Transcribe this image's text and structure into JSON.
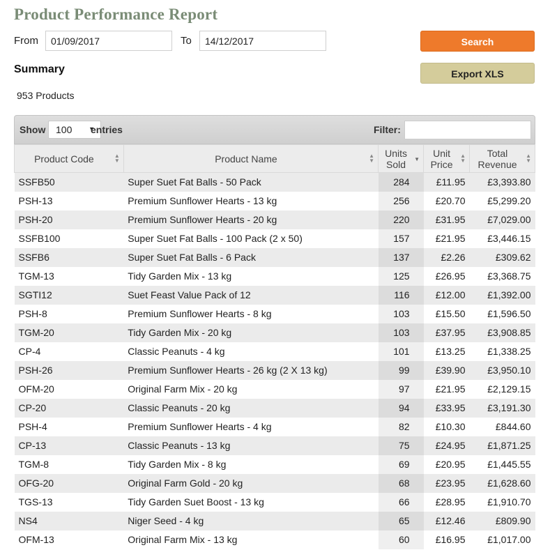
{
  "page": {
    "title": "Product Performance Report"
  },
  "date_range": {
    "from_label": "From",
    "from_value": "01/09/2017",
    "to_label": "To",
    "to_value": "14/12/2017"
  },
  "buttons": {
    "search": "Search",
    "export": "Export XLS"
  },
  "summary": {
    "heading": "Summary",
    "count": "953 Products"
  },
  "table_controls": {
    "show_label": "Show",
    "show_value": "100",
    "entries_label": "entries",
    "filter_label": "Filter:",
    "filter_value": ""
  },
  "columns": [
    {
      "label": "Product Code"
    },
    {
      "label": "Product Name"
    },
    {
      "label": "Units Sold",
      "sorted": "descending"
    },
    {
      "label": "Unit Price"
    },
    {
      "label": "Total Revenue"
    }
  ],
  "rows": [
    {
      "code": "SSFB50",
      "name": "Super Suet Fat Balls - 50 Pack",
      "units": "284",
      "price": "£11.95",
      "revenue": "£3,393.80"
    },
    {
      "code": "PSH-13",
      "name": "Premium Sunflower Hearts - 13 kg",
      "units": "256",
      "price": "£20.70",
      "revenue": "£5,299.20"
    },
    {
      "code": "PSH-20",
      "name": "Premium Sunflower Hearts - 20 kg",
      "units": "220",
      "price": "£31.95",
      "revenue": "£7,029.00"
    },
    {
      "code": "SSFB100",
      "name": "Super Suet Fat Balls - 100 Pack (2 x 50)",
      "units": "157",
      "price": "£21.95",
      "revenue": "£3,446.15"
    },
    {
      "code": "SSFB6",
      "name": "Super Suet Fat Balls - 6 Pack",
      "units": "137",
      "price": "£2.26",
      "revenue": "£309.62"
    },
    {
      "code": "TGM-13",
      "name": "Tidy Garden Mix - 13 kg",
      "units": "125",
      "price": "£26.95",
      "revenue": "£3,368.75"
    },
    {
      "code": "SGTI12",
      "name": "Suet Feast Value Pack of 12",
      "units": "116",
      "price": "£12.00",
      "revenue": "£1,392.00"
    },
    {
      "code": "PSH-8",
      "name": "Premium Sunflower Hearts - 8 kg",
      "units": "103",
      "price": "£15.50",
      "revenue": "£1,596.50"
    },
    {
      "code": "TGM-20",
      "name": "Tidy Garden Mix - 20 kg",
      "units": "103",
      "price": "£37.95",
      "revenue": "£3,908.85"
    },
    {
      "code": "CP-4",
      "name": "Classic Peanuts - 4 kg",
      "units": "101",
      "price": "£13.25",
      "revenue": "£1,338.25"
    },
    {
      "code": "PSH-26",
      "name": "Premium Sunflower Hearts - 26 kg (2 X 13 kg)",
      "units": "99",
      "price": "£39.90",
      "revenue": "£3,950.10"
    },
    {
      "code": "OFM-20",
      "name": "Original Farm Mix - 20 kg",
      "units": "97",
      "price": "£21.95",
      "revenue": "£2,129.15"
    },
    {
      "code": "CP-20",
      "name": "Classic Peanuts - 20 kg",
      "units": "94",
      "price": "£33.95",
      "revenue": "£3,191.30"
    },
    {
      "code": "PSH-4",
      "name": "Premium Sunflower Hearts - 4 kg",
      "units": "82",
      "price": "£10.30",
      "revenue": "£844.60"
    },
    {
      "code": "CP-13",
      "name": "Classic Peanuts - 13 kg",
      "units": "75",
      "price": "£24.95",
      "revenue": "£1,871.25"
    },
    {
      "code": "TGM-8",
      "name": "Tidy Garden Mix - 8 kg",
      "units": "69",
      "price": "£20.95",
      "revenue": "£1,445.55"
    },
    {
      "code": "OFG-20",
      "name": "Original Farm Gold - 20 kg",
      "units": "68",
      "price": "£23.95",
      "revenue": "£1,628.60"
    },
    {
      "code": "TGS-13",
      "name": "Tidy Garden Suet Boost - 13 kg",
      "units": "66",
      "price": "£28.95",
      "revenue": "£1,910.70"
    },
    {
      "code": "NS4",
      "name": "Niger Seed - 4 kg",
      "units": "65",
      "price": "£12.46",
      "revenue": "£809.90"
    },
    {
      "code": "OFM-13",
      "name": "Original Farm Mix - 13 kg",
      "units": "60",
      "price": "£16.95",
      "revenue": "£1,017.00"
    }
  ],
  "colors": {
    "accent_orange": "#ee7a2b",
    "export_tan": "#d4cc9b",
    "title_green": "#7a8c76"
  }
}
